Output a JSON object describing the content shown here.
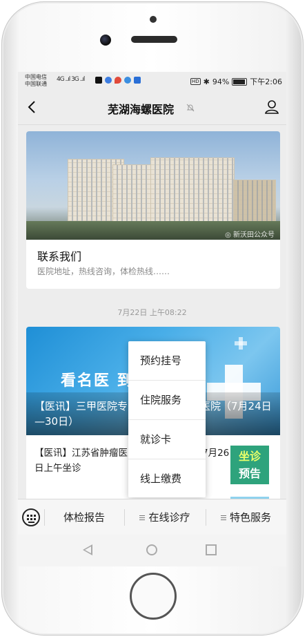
{
  "status_bar": {
    "carrier_1": "中国电信",
    "carrier_2": "中国联通",
    "signal": "4G ..ıl 3G ..ıl",
    "hd_badge": "HD",
    "bluetooth": "✱",
    "battery_text": "94%",
    "battery_level": 0.94,
    "time": "下午2:06"
  },
  "header": {
    "title": "芜湖海螺医院"
  },
  "card_contact": {
    "title": "联系我们",
    "subtitle": "医院地址，热线咨询，体检热线……",
    "watermark": "◎ 新沃田公众号"
  },
  "timestamp": "7月22日 上午08:22",
  "card_news": {
    "banner_text": "看名医 到",
    "overlay_title": "【医讯】三甲医院专家坐诊芜湖海螺医院（7月24日—30日）",
    "news_text": "【医讯】江苏省肿瘤医院主任医师王陈嘉7月26日上午坐诊",
    "badge_line1": "坐诊",
    "badge_line2": "预告"
  },
  "popup_menu": {
    "items": [
      "预约挂号",
      "住院服务",
      "就诊卡",
      "线上缴费"
    ]
  },
  "bottom_menu": {
    "items": [
      "体检报告",
      "在线诊疗",
      "特色服务"
    ]
  },
  "colors": {
    "badge_green": "#2ea37c",
    "banner_blue": "#3aa0e0",
    "screen_bg": "#ededed"
  }
}
